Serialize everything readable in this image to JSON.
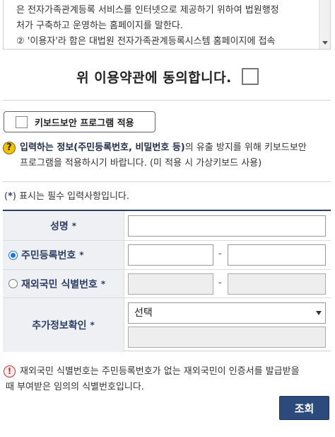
{
  "terms": {
    "lines": [
      "은 전자가족관계등록 서비스를 인터넷으로 제공하기 위하여 법원행정",
      "처가 구축하고 운영하는 홈페이지를 말한다.",
      "② '이용자'라 함은 대법원 전자가족관계등록시스템 홈페이지에 접속"
    ]
  },
  "agreement": {
    "label": "위 이용약관에 동의합니다."
  },
  "keyboard_security": {
    "label": "키보드보안 프로그램 적용"
  },
  "notice": {
    "icon": "?",
    "line1_bold": "입력하는 정보(주민등록번호, 비밀번호 등)",
    "line1_rest": "의 유출 방지를 위해 키보드보안",
    "line2": "프로그램을 적용하시기 바랍니다. (미 적용 시 가상키보드 사용)"
  },
  "required_note": {
    "open": "(",
    "star": "*",
    "text": ") 표시는 필수 입력사항입니다."
  },
  "form": {
    "name_label": "성명",
    "rrn_label": "주민등록번호",
    "foreign_label": "재외국민 식별번호",
    "extra_label": "추가정보확인",
    "required_star": "*",
    "dash": "-",
    "select_value": "선택",
    "rrn_selected": true
  },
  "info": {
    "icon": "!",
    "line1": "재외국민 식별번호는 주민등록번호가 없는 재외국민이 인증서를 발급받을",
    "line2": "때 부여받은 임의의 식별번호입니다."
  },
  "buttons": {
    "search_label": "조회"
  },
  "colors": {
    "primary_navy": "#2c3e63",
    "button_navy": "#2c4a7c",
    "label_bg": "#eef0f4",
    "help_yellow": "#f3c300",
    "alert_red": "#b33333"
  }
}
